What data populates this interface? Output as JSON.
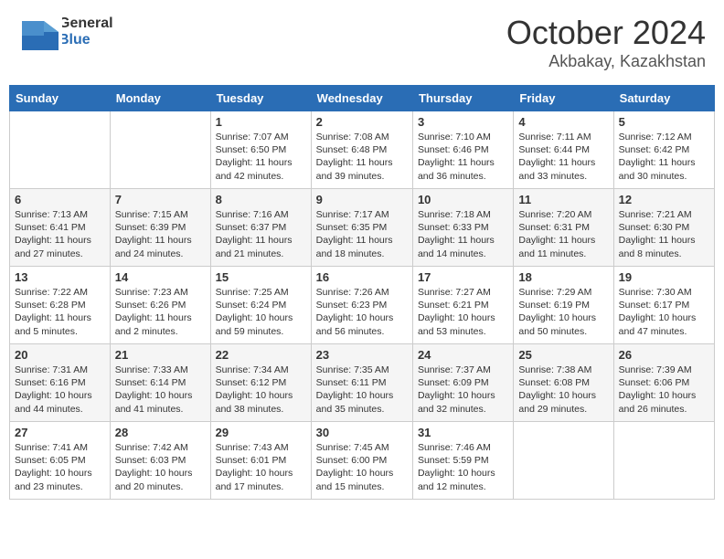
{
  "header": {
    "logo_general": "General",
    "logo_blue": "Blue",
    "month": "October 2024",
    "location": "Akbakay, Kazakhstan"
  },
  "days_of_week": [
    "Sunday",
    "Monday",
    "Tuesday",
    "Wednesday",
    "Thursday",
    "Friday",
    "Saturday"
  ],
  "weeks": [
    [
      {
        "day": "",
        "sunrise": "",
        "sunset": "",
        "daylight": ""
      },
      {
        "day": "",
        "sunrise": "",
        "sunset": "",
        "daylight": ""
      },
      {
        "day": "1",
        "sunrise": "Sunrise: 7:07 AM",
        "sunset": "Sunset: 6:50 PM",
        "daylight": "Daylight: 11 hours and 42 minutes."
      },
      {
        "day": "2",
        "sunrise": "Sunrise: 7:08 AM",
        "sunset": "Sunset: 6:48 PM",
        "daylight": "Daylight: 11 hours and 39 minutes."
      },
      {
        "day": "3",
        "sunrise": "Sunrise: 7:10 AM",
        "sunset": "Sunset: 6:46 PM",
        "daylight": "Daylight: 11 hours and 36 minutes."
      },
      {
        "day": "4",
        "sunrise": "Sunrise: 7:11 AM",
        "sunset": "Sunset: 6:44 PM",
        "daylight": "Daylight: 11 hours and 33 minutes."
      },
      {
        "day": "5",
        "sunrise": "Sunrise: 7:12 AM",
        "sunset": "Sunset: 6:42 PM",
        "daylight": "Daylight: 11 hours and 30 minutes."
      }
    ],
    [
      {
        "day": "6",
        "sunrise": "Sunrise: 7:13 AM",
        "sunset": "Sunset: 6:41 PM",
        "daylight": "Daylight: 11 hours and 27 minutes."
      },
      {
        "day": "7",
        "sunrise": "Sunrise: 7:15 AM",
        "sunset": "Sunset: 6:39 PM",
        "daylight": "Daylight: 11 hours and 24 minutes."
      },
      {
        "day": "8",
        "sunrise": "Sunrise: 7:16 AM",
        "sunset": "Sunset: 6:37 PM",
        "daylight": "Daylight: 11 hours and 21 minutes."
      },
      {
        "day": "9",
        "sunrise": "Sunrise: 7:17 AM",
        "sunset": "Sunset: 6:35 PM",
        "daylight": "Daylight: 11 hours and 18 minutes."
      },
      {
        "day": "10",
        "sunrise": "Sunrise: 7:18 AM",
        "sunset": "Sunset: 6:33 PM",
        "daylight": "Daylight: 11 hours and 14 minutes."
      },
      {
        "day": "11",
        "sunrise": "Sunrise: 7:20 AM",
        "sunset": "Sunset: 6:31 PM",
        "daylight": "Daylight: 11 hours and 11 minutes."
      },
      {
        "day": "12",
        "sunrise": "Sunrise: 7:21 AM",
        "sunset": "Sunset: 6:30 PM",
        "daylight": "Daylight: 11 hours and 8 minutes."
      }
    ],
    [
      {
        "day": "13",
        "sunrise": "Sunrise: 7:22 AM",
        "sunset": "Sunset: 6:28 PM",
        "daylight": "Daylight: 11 hours and 5 minutes."
      },
      {
        "day": "14",
        "sunrise": "Sunrise: 7:23 AM",
        "sunset": "Sunset: 6:26 PM",
        "daylight": "Daylight: 11 hours and 2 minutes."
      },
      {
        "day": "15",
        "sunrise": "Sunrise: 7:25 AM",
        "sunset": "Sunset: 6:24 PM",
        "daylight": "Daylight: 10 hours and 59 minutes."
      },
      {
        "day": "16",
        "sunrise": "Sunrise: 7:26 AM",
        "sunset": "Sunset: 6:23 PM",
        "daylight": "Daylight: 10 hours and 56 minutes."
      },
      {
        "day": "17",
        "sunrise": "Sunrise: 7:27 AM",
        "sunset": "Sunset: 6:21 PM",
        "daylight": "Daylight: 10 hours and 53 minutes."
      },
      {
        "day": "18",
        "sunrise": "Sunrise: 7:29 AM",
        "sunset": "Sunset: 6:19 PM",
        "daylight": "Daylight: 10 hours and 50 minutes."
      },
      {
        "day": "19",
        "sunrise": "Sunrise: 7:30 AM",
        "sunset": "Sunset: 6:17 PM",
        "daylight": "Daylight: 10 hours and 47 minutes."
      }
    ],
    [
      {
        "day": "20",
        "sunrise": "Sunrise: 7:31 AM",
        "sunset": "Sunset: 6:16 PM",
        "daylight": "Daylight: 10 hours and 44 minutes."
      },
      {
        "day": "21",
        "sunrise": "Sunrise: 7:33 AM",
        "sunset": "Sunset: 6:14 PM",
        "daylight": "Daylight: 10 hours and 41 minutes."
      },
      {
        "day": "22",
        "sunrise": "Sunrise: 7:34 AM",
        "sunset": "Sunset: 6:12 PM",
        "daylight": "Daylight: 10 hours and 38 minutes."
      },
      {
        "day": "23",
        "sunrise": "Sunrise: 7:35 AM",
        "sunset": "Sunset: 6:11 PM",
        "daylight": "Daylight: 10 hours and 35 minutes."
      },
      {
        "day": "24",
        "sunrise": "Sunrise: 7:37 AM",
        "sunset": "Sunset: 6:09 PM",
        "daylight": "Daylight: 10 hours and 32 minutes."
      },
      {
        "day": "25",
        "sunrise": "Sunrise: 7:38 AM",
        "sunset": "Sunset: 6:08 PM",
        "daylight": "Daylight: 10 hours and 29 minutes."
      },
      {
        "day": "26",
        "sunrise": "Sunrise: 7:39 AM",
        "sunset": "Sunset: 6:06 PM",
        "daylight": "Daylight: 10 hours and 26 minutes."
      }
    ],
    [
      {
        "day": "27",
        "sunrise": "Sunrise: 7:41 AM",
        "sunset": "Sunset: 6:05 PM",
        "daylight": "Daylight: 10 hours and 23 minutes."
      },
      {
        "day": "28",
        "sunrise": "Sunrise: 7:42 AM",
        "sunset": "Sunset: 6:03 PM",
        "daylight": "Daylight: 10 hours and 20 minutes."
      },
      {
        "day": "29",
        "sunrise": "Sunrise: 7:43 AM",
        "sunset": "Sunset: 6:01 PM",
        "daylight": "Daylight: 10 hours and 17 minutes."
      },
      {
        "day": "30",
        "sunrise": "Sunrise: 7:45 AM",
        "sunset": "Sunset: 6:00 PM",
        "daylight": "Daylight: 10 hours and 15 minutes."
      },
      {
        "day": "31",
        "sunrise": "Sunrise: 7:46 AM",
        "sunset": "Sunset: 5:59 PM",
        "daylight": "Daylight: 10 hours and 12 minutes."
      },
      {
        "day": "",
        "sunrise": "",
        "sunset": "",
        "daylight": ""
      },
      {
        "day": "",
        "sunrise": "",
        "sunset": "",
        "daylight": ""
      }
    ]
  ]
}
